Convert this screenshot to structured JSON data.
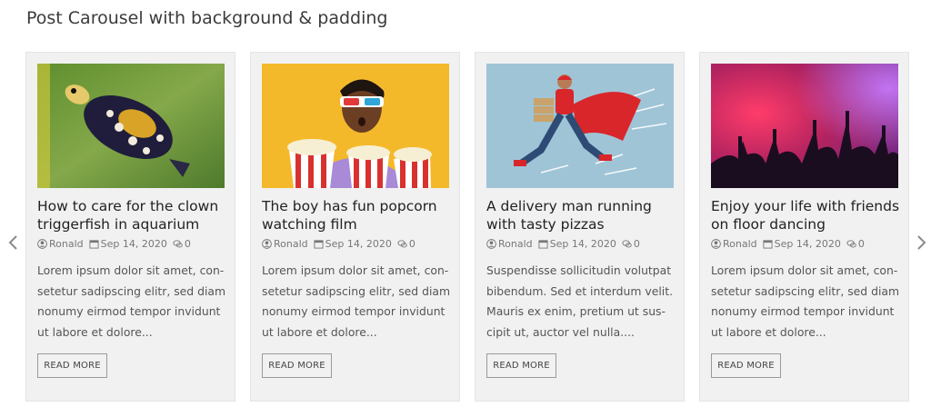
{
  "page": {
    "title": "Post Carousel with background & padding"
  },
  "carousel": {
    "prev_icon": "chevron-left-icon",
    "next_icon": "chevron-right-icon",
    "read_more_label": "READ MORE",
    "posts": [
      {
        "title": "How to care for the clown triggerfish in aquarium",
        "author": "Ronald",
        "date": "Sep 14, 2020",
        "comments": "0",
        "excerpt": "Lorem ipsum dolor sit amet, con- setetur sadipscing elitr, sed diam nonumy eirmod tempor invidunt ut labore et dolore..."
      },
      {
        "title": "The boy has fun popcorn watching film",
        "author": "Ronald",
        "date": "Sep 14, 2020",
        "comments": "0",
        "excerpt": "Lorem ipsum dolor sit amet, con- setetur sadipscing elitr, sed diam nonumy eirmod tempor invidunt ut labore et dolore..."
      },
      {
        "title": "A delivery man running with tasty pizzas",
        "author": "Ronald",
        "date": "Sep 14, 2020",
        "comments": "0",
        "excerpt": "Suspendisse sollicitudin volutpat bibendum. Sed et interdum velit. Mauris ex enim, pretium ut sus- cipit ut, auctor vel nulla...."
      },
      {
        "title": "Enjoy your life with friends on floor dancing",
        "author": "Ronald",
        "date": "Sep 14, 2020",
        "comments": "0",
        "excerpt": "Lorem ipsum dolor sit amet, con- setetur sadipscing elitr, sed diam nonumy eirmod tempor invidunt ut labore et dolore..."
      }
    ]
  },
  "colors": {
    "card_bg": "#f1f1f1",
    "arrow": "#8a8a8a",
    "meta": "#777777"
  }
}
